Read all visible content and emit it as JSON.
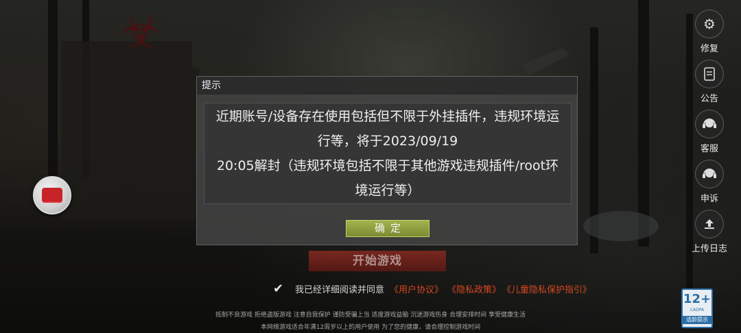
{
  "background": {
    "logo_icon": "biohazard-logo"
  },
  "side_menu": [
    {
      "icon": "gear-icon",
      "label": "修复"
    },
    {
      "icon": "document-icon",
      "label": "公告"
    },
    {
      "icon": "headset-icon",
      "label": "客服"
    },
    {
      "icon": "headset-icon",
      "label": "申诉"
    },
    {
      "icon": "upload-icon",
      "label": "上传日志"
    }
  ],
  "start_button": {
    "label": "开始游戏"
  },
  "agreement": {
    "text": "我已经详细阅读并同意",
    "link_user": "《用户协议》",
    "link_privacy": "《隐私政策》",
    "link_children": "《儿童隐私保护指引》"
  },
  "health_notice": {
    "line1": "抵制不良游戏 拒绝盗版游戏 注意自我保护 谨防受骗上当 适度游戏益脑 沉迷游戏伤身 合理安排时间 享受健康生活",
    "line2": "本网络游戏适合年满12周岁以上的用户使用   为了您的健康，请合理控制游戏时间"
  },
  "age_rating": {
    "number": "12+",
    "org": "CADPA",
    "text": "适龄提示"
  },
  "dialog": {
    "title": "提示",
    "message_lines": [
      "近期账号/设备存在使用包括但不限于外挂插件，违规环境运",
      "行等，将于2023/09/19",
      "20:05解封（违规环境包括不限于其他游戏违规插件/root环",
      "境运行等）"
    ],
    "confirm_label": "确定"
  },
  "colors": {
    "accent_link": "#d4471f",
    "confirm_button": "#8e9d3f",
    "start_button": "#7a241d"
  }
}
